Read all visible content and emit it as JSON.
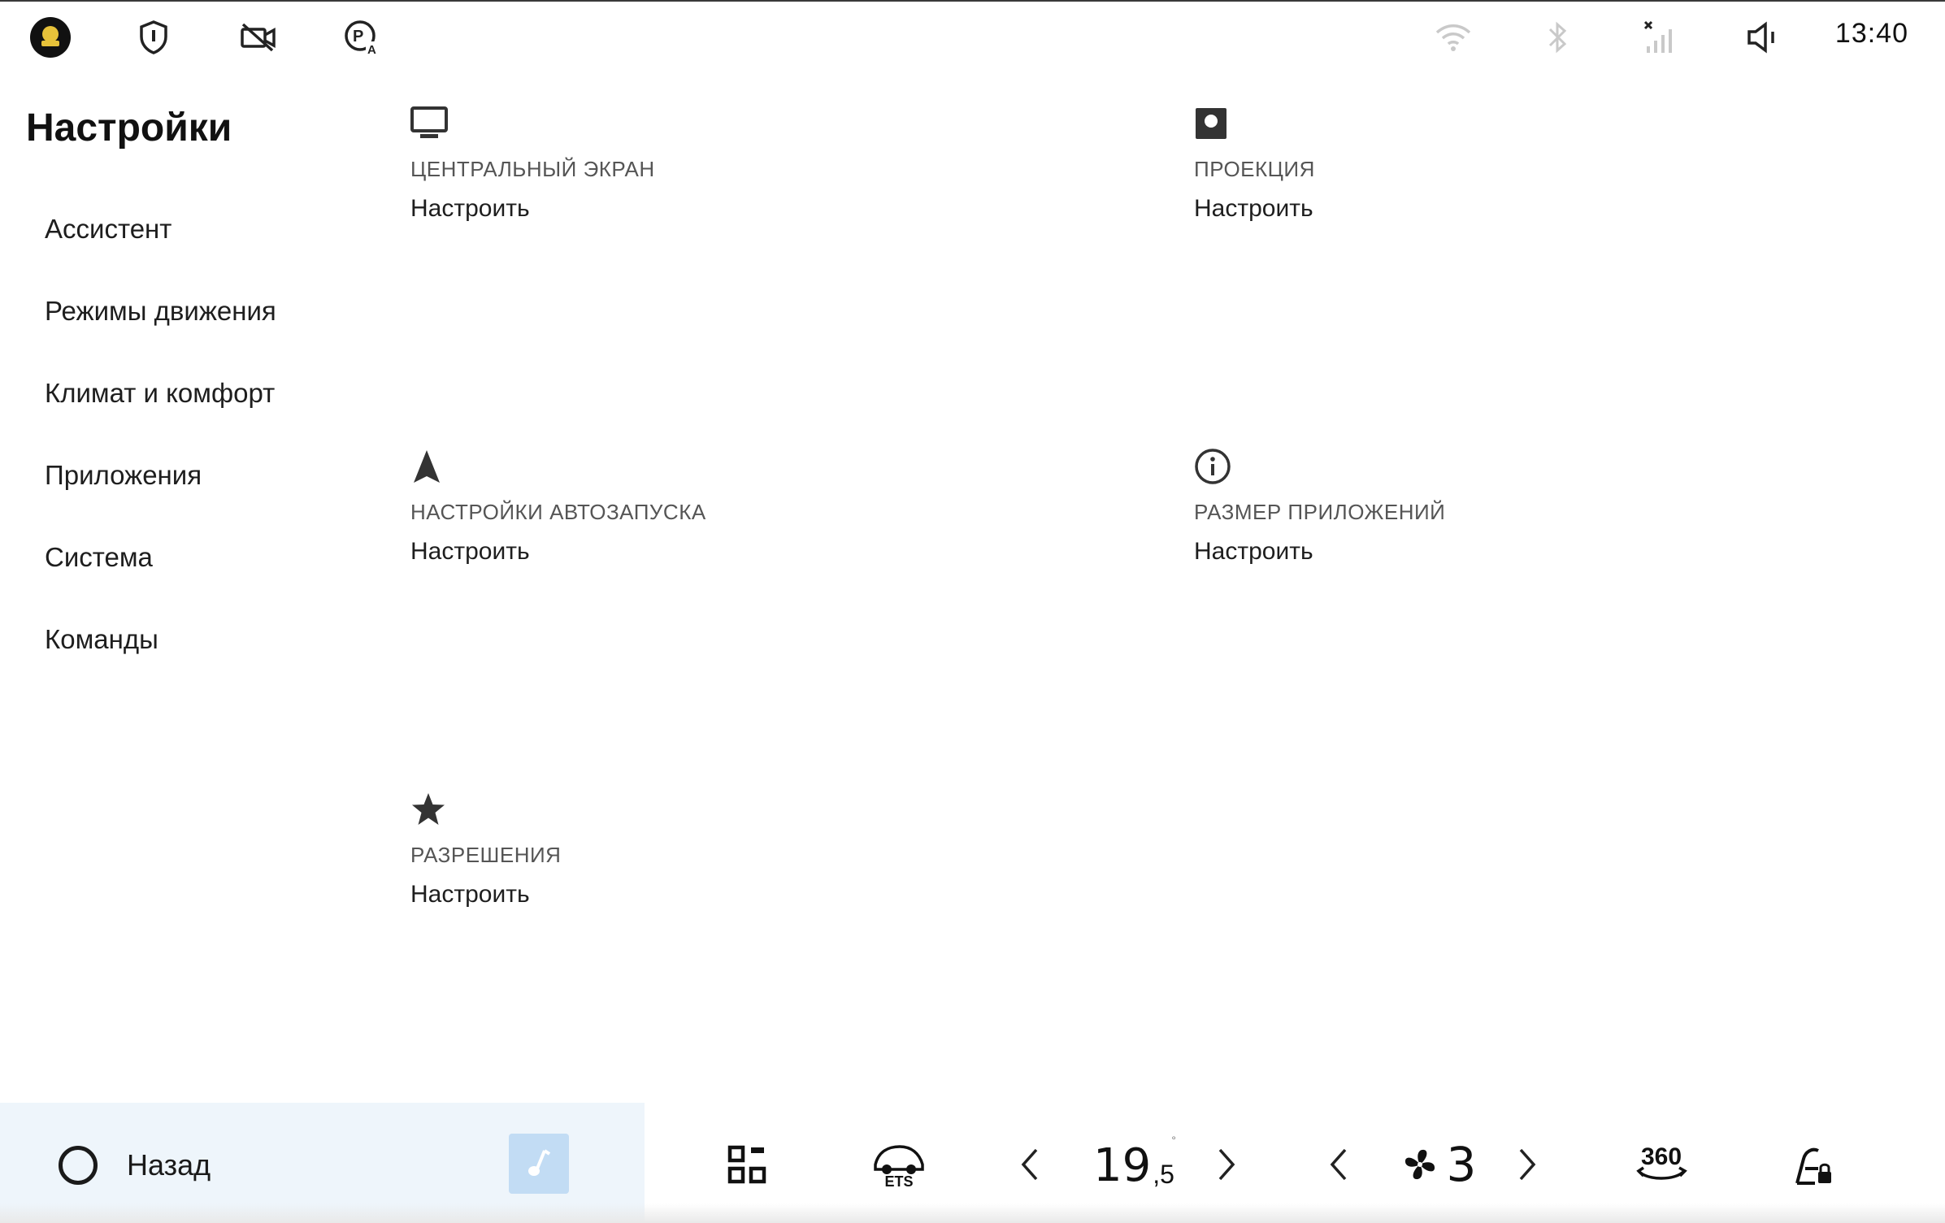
{
  "status_bar": {
    "time": "13:40",
    "icons": [
      "ets-logo-icon",
      "shield-icon",
      "camera-off-icon",
      "parking-assist-icon",
      "wifi-icon",
      "bluetooth-icon",
      "signal-off-icon",
      "volume-icon"
    ]
  },
  "sidebar": {
    "title": "Настройки",
    "items": [
      {
        "label": "Ассистент"
      },
      {
        "label": "Режимы движения"
      },
      {
        "label": "Климат и комфорт"
      },
      {
        "label": "Приложения"
      },
      {
        "label": "Система"
      },
      {
        "label": "Команды"
      }
    ]
  },
  "tiles": [
    {
      "icon": "monitor-icon",
      "title": "ЦЕНТРАЛЬНЫЙ ЭКРАН",
      "action": "Настроить"
    },
    {
      "icon": "projection-icon",
      "title": "ПРОЕКЦИЯ",
      "action": "Настроить"
    },
    {
      "icon": "navigation-arrow-icon",
      "title": "НАСТРОЙКИ АВТОЗАПУСКА",
      "action": "Настроить"
    },
    {
      "icon": "info-icon",
      "title": "РАЗМЕР ПРИЛОЖЕНИЙ",
      "action": "Настроить"
    },
    {
      "icon": "star-icon",
      "title": "РАЗРЕШЕНИЯ",
      "action": "Настроить"
    }
  ],
  "bottom_bar": {
    "back_label": "Назад",
    "temperature_int": "19",
    "temperature_dec": ",5",
    "temperature_unit": "°",
    "fan_level": "3",
    "view_360_label": "360",
    "ets_label": "ETS"
  },
  "colors": {
    "bottom_left_bg": "#eef5fb",
    "music_button_bg": "#c2dcf4",
    "accent_dark": "#1a1a1a"
  }
}
